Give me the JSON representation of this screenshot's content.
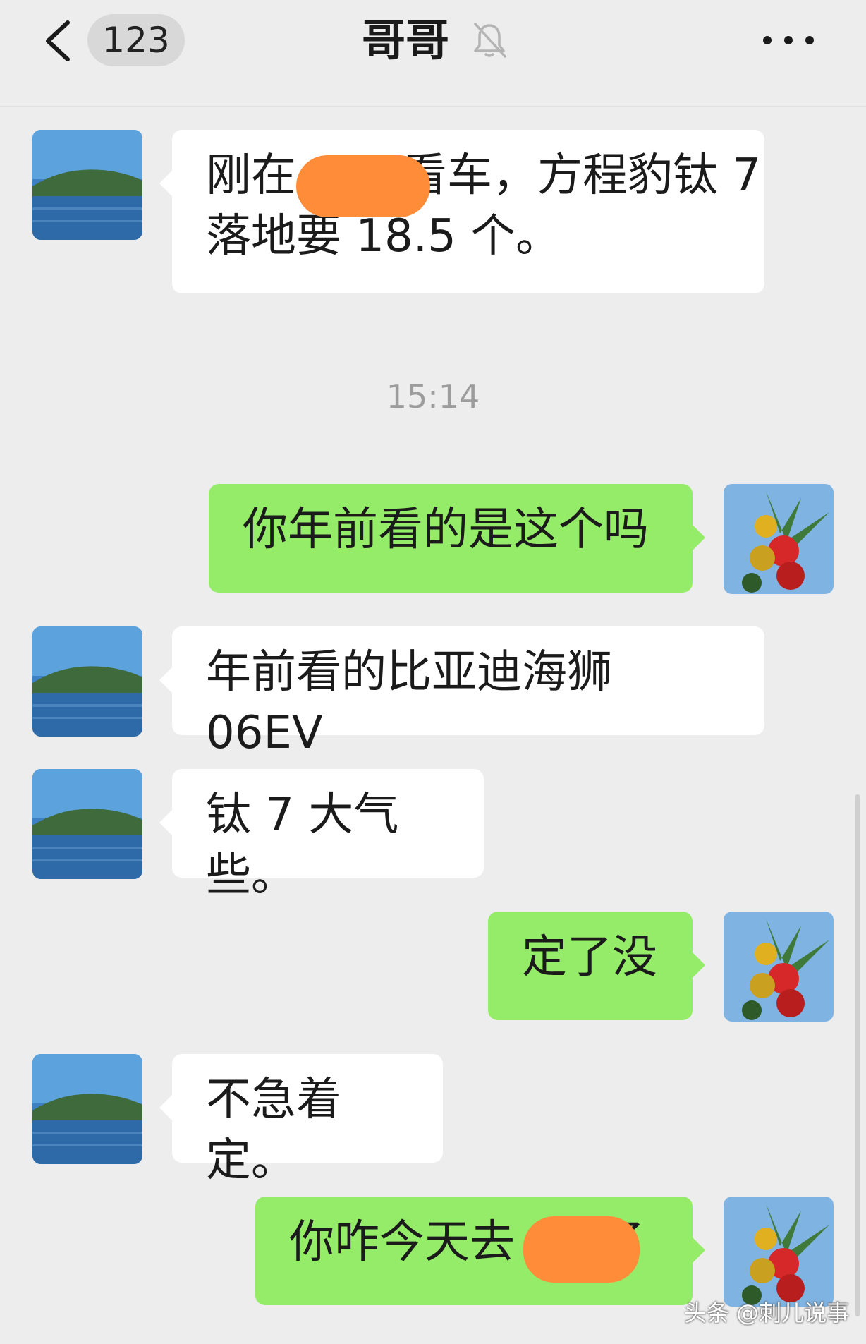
{
  "header": {
    "back_icon": "chevron-left-icon",
    "unread_count": "123",
    "title": "哥哥",
    "mute_icon": "bell-off-icon",
    "more_icon": "more-dots-icon"
  },
  "timestamp": "15:14",
  "messages": [
    {
      "side": "in",
      "text_before": "刚在",
      "text_after": "看车，方程豹钛 7",
      "line2": "落地要 18.5 个。"
    },
    {
      "side": "out",
      "text": "你年前看的是这个吗"
    },
    {
      "side": "in",
      "text": "年前看的比亚迪海狮 06EV"
    },
    {
      "side": "in",
      "text": "钛 7 大气些。"
    },
    {
      "side": "out",
      "text": "定了没"
    },
    {
      "side": "in",
      "text": "不急着定。"
    },
    {
      "side": "out",
      "text_before": "你咋今天去",
      "text_after": "了"
    }
  ],
  "colors": {
    "background": "#ededed",
    "incoming_bubble": "#ffffff",
    "outgoing_bubble": "#95ec69",
    "redaction": "#ff8c38"
  },
  "watermark": "头条 @刺儿说事"
}
